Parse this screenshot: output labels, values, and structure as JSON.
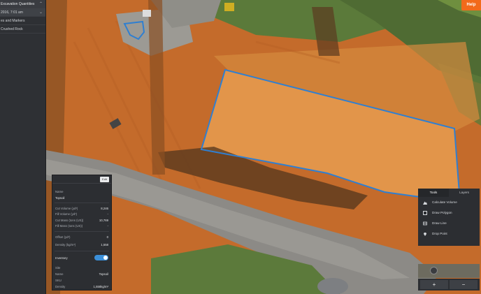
{
  "sidebar": {
    "items": [
      {
        "label": "Excavation Quantities",
        "has_chevron": true
      },
      {
        "label": "2016, 7:01 am",
        "has_chevron": true
      },
      {
        "label": "es and Markers"
      },
      {
        "label": "Crushed Rock"
      }
    ]
  },
  "help_label": "Help",
  "details": {
    "edit_label": "Edit",
    "name_label": "Name",
    "name_value": "Topsoil",
    "cut_volume_label": "Cut Volume (yd³)",
    "cut_volume_value": "8,246",
    "fill_volume_label": "Fill Volume (yd³)",
    "fill_volume_value": "-",
    "cut_mass_label": "Cut Mass (tons (US))",
    "cut_mass_value": "10,769",
    "fill_mass_label": "Fill Mass (tons (US))",
    "fill_mass_value": "-",
    "offset_label": "Offset (yd³)",
    "offset_value": "0",
    "density_label": "Density (kg/m³)",
    "density_value": "1,558",
    "inventory_label": "Inventory",
    "inventory_on": true,
    "site_label": "Site",
    "site_value": "",
    "inv_name_label": "Name",
    "inv_name_value": "Topsoil",
    "sku_label": "SKU",
    "sku_value": "",
    "inv_density_label": "Density",
    "inv_density_value": "1,558kg/m³"
  },
  "tools": {
    "tabs": [
      "Tools",
      "Layers"
    ],
    "active_tab": 0,
    "items": [
      {
        "label": "Calculate Volume",
        "icon": "mountain-icon"
      },
      {
        "label": "Draw Polygon",
        "icon": "polygon-icon"
      },
      {
        "label": "Draw Line",
        "icon": "line-icon"
      },
      {
        "label": "Drop Point",
        "icon": "pin-icon"
      }
    ],
    "zoom_in": "+",
    "zoom_out": "−"
  },
  "colors": {
    "accent": "#f26a1b",
    "polygon": "#2f7fd1",
    "toggle": "#3b8fd9",
    "panel": "#2c2e32"
  }
}
